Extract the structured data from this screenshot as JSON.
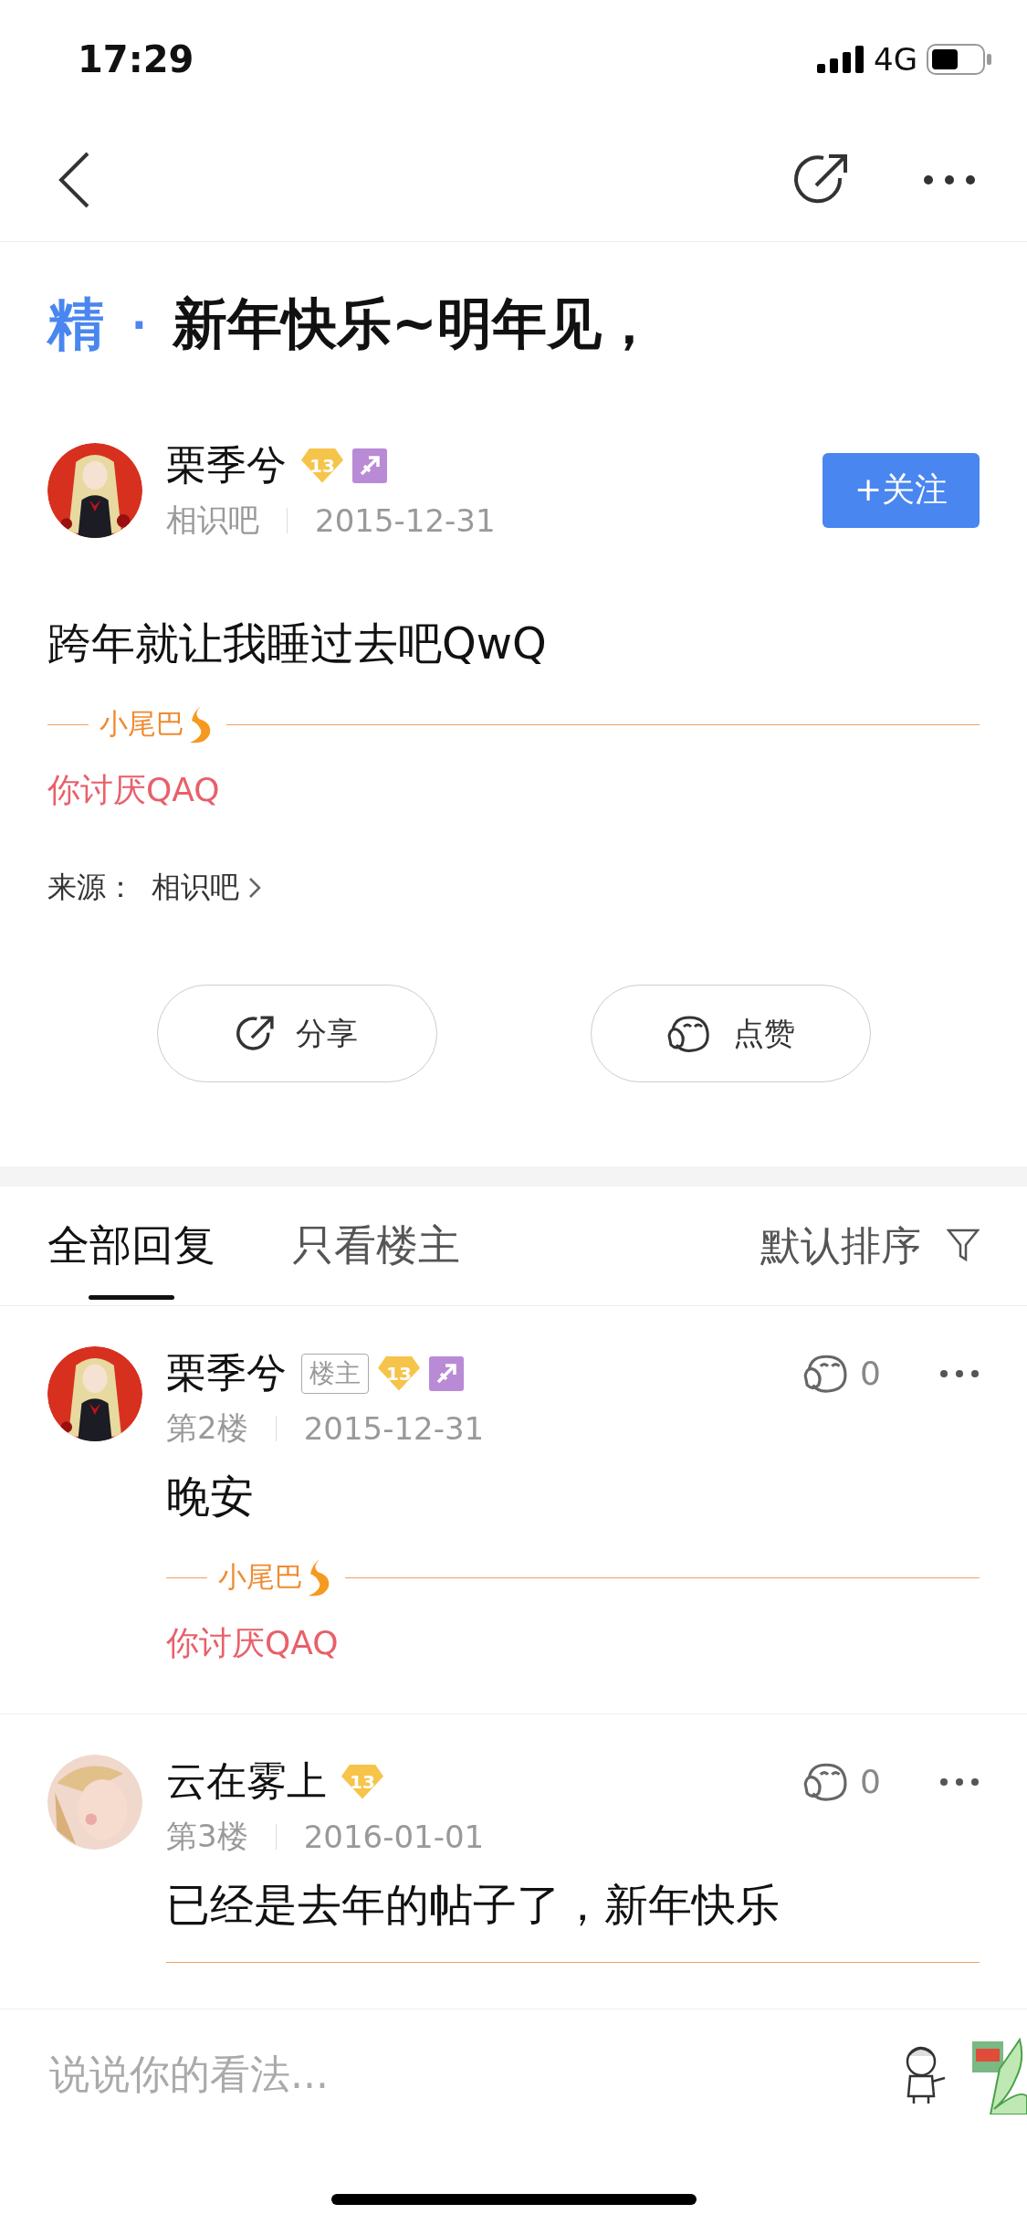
{
  "status_bar": {
    "time": "17:29",
    "network": "4G"
  },
  "post": {
    "badge": "精",
    "separator": "·",
    "title": "新年快乐~明年见，",
    "author": {
      "name": "栗季兮",
      "level": "13",
      "zodiac": true,
      "forum": "相识吧",
      "date": "2015-12-31"
    },
    "follow_button": "+关注",
    "body": "跨年就让我睡过去吧QwQ",
    "tail": {
      "label": "小尾巴",
      "text": "你讨厌QAQ"
    },
    "source": {
      "label": "来源：",
      "forum": "相识吧"
    },
    "actions": [
      {
        "kind": "share",
        "label": "分享"
      },
      {
        "kind": "like",
        "label": "点赞"
      }
    ]
  },
  "tabs": [
    {
      "label": "全部回复",
      "selected": true
    },
    {
      "label": "只看楼主",
      "selected": false
    }
  ],
  "sort": "默认排序",
  "replies": [
    {
      "name": "栗季兮",
      "op_tag": "楼主",
      "level": "13",
      "zodiac": true,
      "floor": "第2楼",
      "date": "2015-12-31",
      "likes": "0",
      "body": "晚安",
      "tail": {
        "label": "小尾巴",
        "text": "你讨厌QAQ"
      }
    },
    {
      "name": "云在雾上",
      "level": "13",
      "floor": "第3楼",
      "date": "2016-01-01",
      "likes": "0",
      "body": "已经是去年的帖子了，新年快乐",
      "tail_cut": true
    }
  ],
  "comment_input": {
    "placeholder": "说说你的看法..."
  }
}
